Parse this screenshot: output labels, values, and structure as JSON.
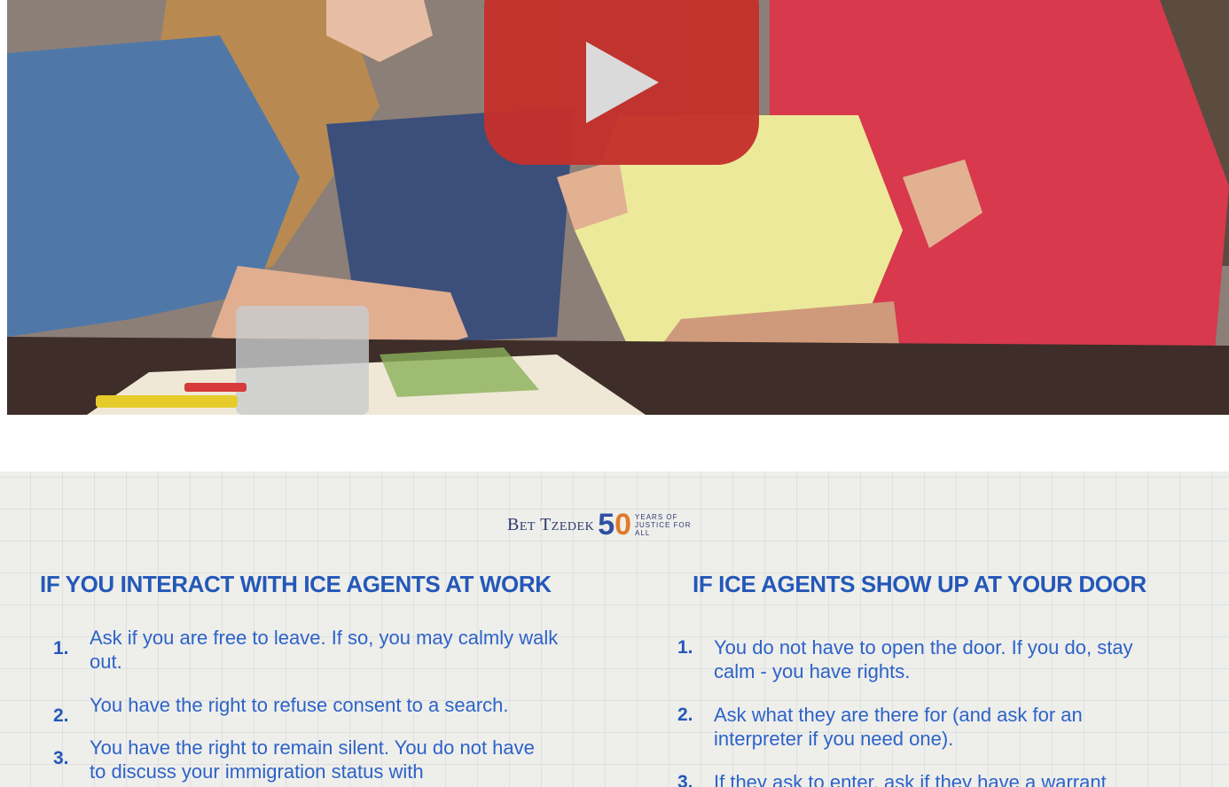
{
  "video": {
    "play_icon": "play-icon",
    "button_color": "#c4302b"
  },
  "flyer": {
    "logo": {
      "name": "Bet Tzedek",
      "number": "50",
      "tagline": "Years of Justice for All"
    },
    "left": {
      "title": "IF YOU INTERACT WITH ICE AGENTS AT WORK",
      "items": [
        {
          "num": "1.",
          "text": "Ask if you are free to leave. If so, you may calmly walk out."
        },
        {
          "num": "2.",
          "text": "You have the right to refuse consent to a search."
        },
        {
          "num": "3.",
          "text": "You have the right to remain silent. You do not have to discuss your immigration status with"
        }
      ]
    },
    "right": {
      "title": "IF ICE AGENTS SHOW UP AT YOUR DOOR",
      "items": [
        {
          "num": "1.",
          "text": "You do not have to open the door. If you do, stay calm - you have rights."
        },
        {
          "num": "2.",
          "text": "Ask what they are there for (and ask for an interpreter if you need one)."
        },
        {
          "num": "3.",
          "text": "If they ask to enter, ask if they have a warrant"
        }
      ]
    },
    "title_color": "#2458b8",
    "text_color": "#2d63c8"
  }
}
